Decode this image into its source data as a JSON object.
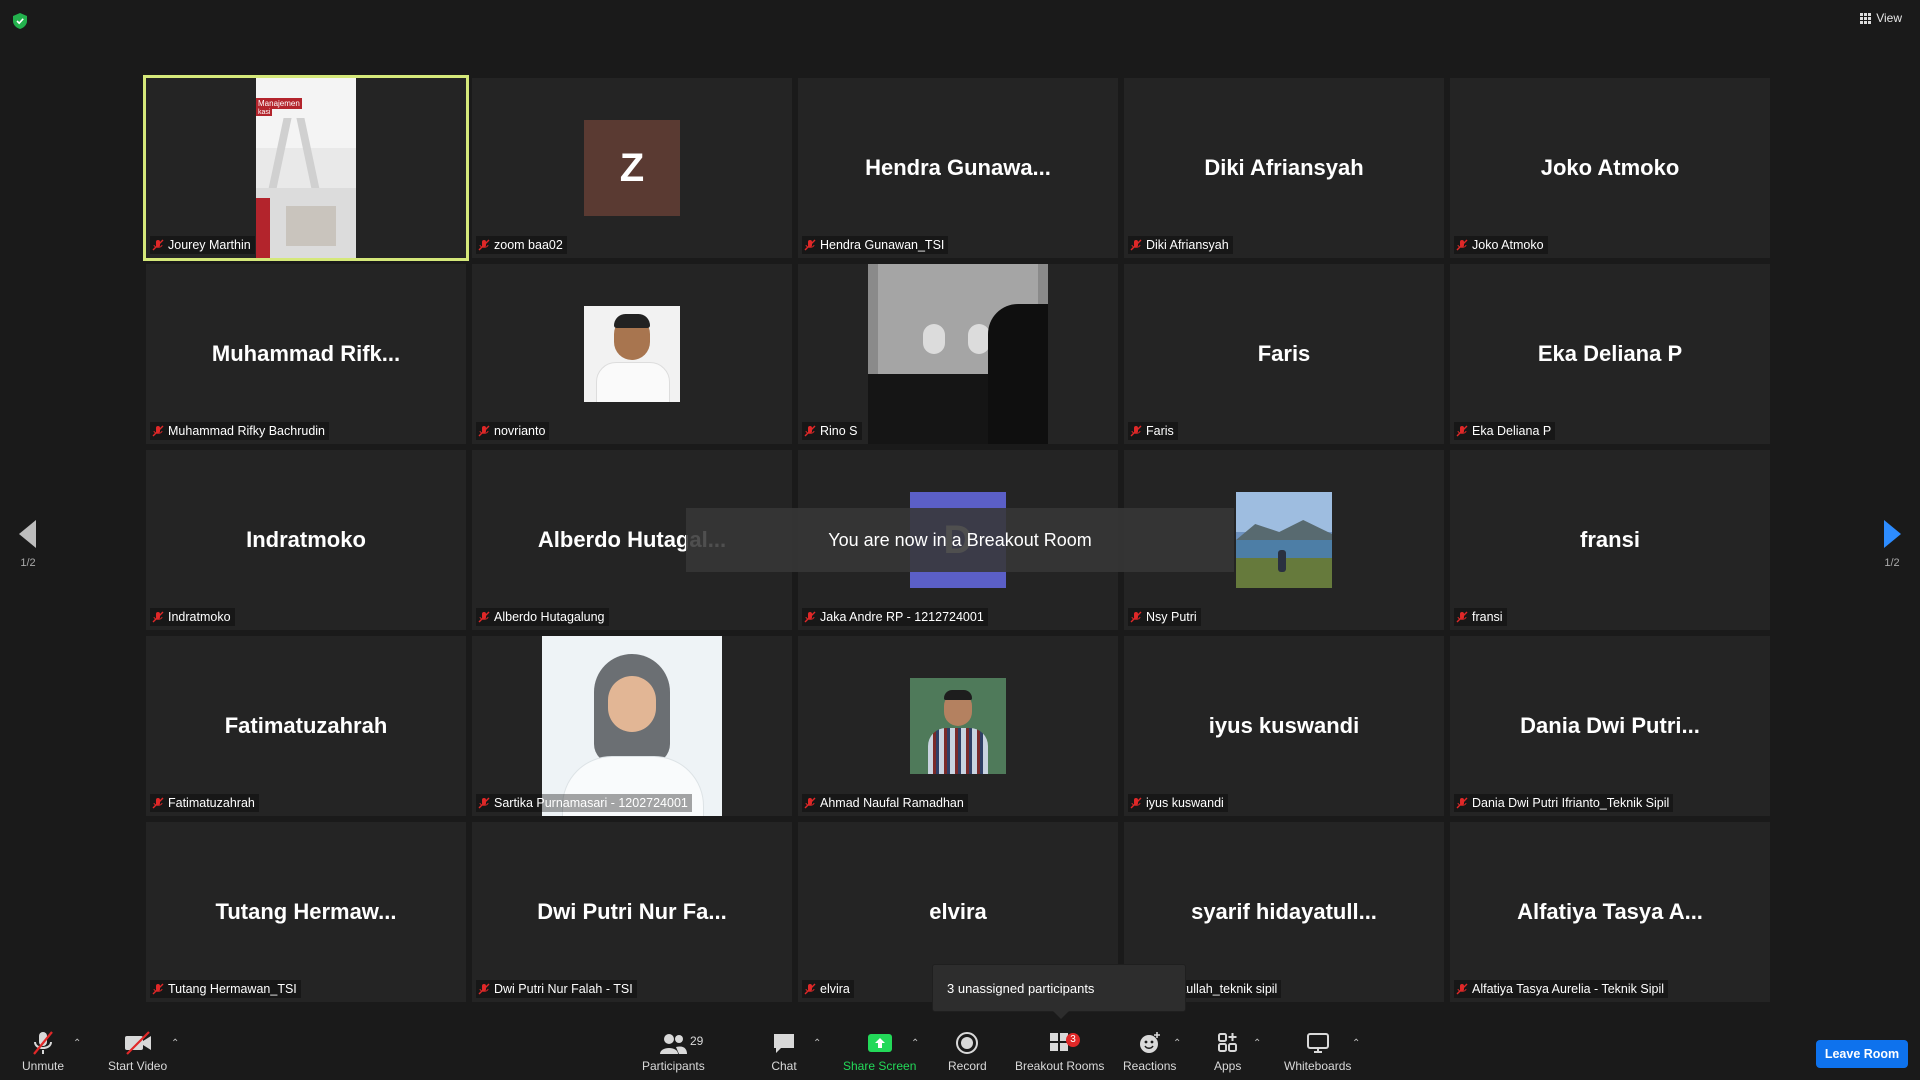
{
  "top": {
    "view_label": "View"
  },
  "pagination": {
    "left": "1/2",
    "right": "1/2"
  },
  "toast": "You are now in a Breakout Room",
  "tooltip": "3 unassigned participants",
  "tiles": [
    {
      "display": "",
      "label": "Jourey Marthin",
      "video": "jourey-video",
      "overlay_text": [
        "Manajemen",
        "kasi"
      ]
    },
    {
      "display": "",
      "label": "zoom baa02",
      "avatar_letter": "Z",
      "avatar_color": "#5a3a32"
    },
    {
      "display": "Hendra  Gunawa...",
      "label": "Hendra Gunawan_TSI"
    },
    {
      "display": "Diki Afriansyah",
      "label": "Diki Afriansyah"
    },
    {
      "display": "Joko Atmoko",
      "label": "Joko Atmoko"
    },
    {
      "display": "Muhammad  Rifk...",
      "label": "Muhammad Rifky Bachrudin"
    },
    {
      "display": "",
      "label": "novrianto",
      "photo": "novrianto-photo"
    },
    {
      "display": "",
      "label": "Rino S",
      "video": "rino-video"
    },
    {
      "display": "Faris",
      "label": "Faris"
    },
    {
      "display": "Eka Deliana P",
      "label": "Eka Deliana P"
    },
    {
      "display": "Indratmoko",
      "label": "Indratmoko"
    },
    {
      "display": "Alberdo  Hutagal...",
      "label": "Alberdo Hutagalung"
    },
    {
      "display": "",
      "label": "Jaka Andre RP - 1212724001",
      "avatar_letter": "D",
      "avatar_color": "#5b5fc7"
    },
    {
      "display": "",
      "label": "Nsy Putri",
      "photo": "nsy-photo"
    },
    {
      "display": "fransi",
      "label": "fransi"
    },
    {
      "display": "Fatimatuzahrah",
      "label": "Fatimatuzahrah"
    },
    {
      "display": "",
      "label": "Sartika Purnamasari - 1202724001",
      "photo": "sartika-photo"
    },
    {
      "display": "",
      "label": "Ahmad Naufal Ramadhan",
      "photo": "ahmad-photo"
    },
    {
      "display": "iyus kuswandi",
      "label": "iyus kuswandi"
    },
    {
      "display": "Dania  Dwi  Putri...",
      "label": "Dania Dwi Putri Ifrianto_Teknik Sipil"
    },
    {
      "display": "Tutang  Hermaw...",
      "label": "Tutang Hermawan_TSI"
    },
    {
      "display": "Dwi Putri Nur Fa...",
      "label": "Dwi Putri Nur Falah - TSI"
    },
    {
      "display": "elvira",
      "label": "elvira"
    },
    {
      "display": "syarif  hidayatull...",
      "label": "nidayatullah_teknik sipil"
    },
    {
      "display": "Alfatiya  Tasya  A...",
      "label": "Alfatiya Tasya Aurelia - Teknik Sipil"
    }
  ],
  "toolbar": {
    "unmute": "Unmute",
    "start_video": "Start Video",
    "participants": "Participants",
    "participants_count": "29",
    "chat": "Chat",
    "share_screen": "Share Screen",
    "record": "Record",
    "breakout_rooms": "Breakout Rooms",
    "breakout_badge": "3",
    "reactions": "Reactions",
    "apps": "Apps",
    "whiteboards": "Whiteboards",
    "leave_room": "Leave Room"
  },
  "colors": {
    "accent_blue": "#0e72ed",
    "active_speaker": "#d5e87a",
    "share_green": "#23d959",
    "muted_red": "#e02828"
  }
}
